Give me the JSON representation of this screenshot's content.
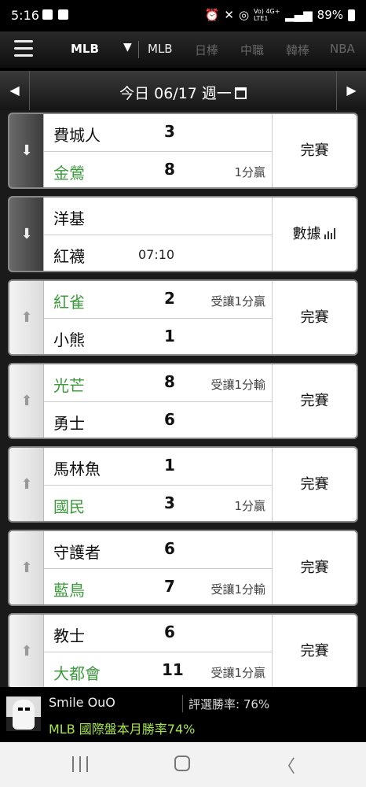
{
  "status_bar": {
    "time": "5:16",
    "network": "Vo) 4G+ LTE1",
    "battery": "89%"
  },
  "nav": {
    "selected_league": "MLB",
    "tabs": [
      "MLB",
      "日棒",
      "中職",
      "韓棒",
      "NBA"
    ]
  },
  "date_bar": {
    "date_text": "今日 06/17 週一"
  },
  "games": [
    {
      "arrow": "down",
      "away": {
        "name": "費城人",
        "score": "3",
        "note": "",
        "win": false
      },
      "home": {
        "name": "金鶯",
        "score": "8",
        "note": "1分贏",
        "win": true
      },
      "status": "完賽"
    },
    {
      "arrow": "down",
      "away": {
        "name": "洋基",
        "score": "",
        "note": "",
        "win": false
      },
      "home": {
        "name": "紅襪",
        "score": "",
        "note": "",
        "win": false,
        "time": "07:10"
      },
      "status": "數據"
    },
    {
      "arrow": "up",
      "away": {
        "name": "紅雀",
        "score": "2",
        "note": "受讓1分贏",
        "win": true
      },
      "home": {
        "name": "小熊",
        "score": "1",
        "note": "",
        "win": false
      },
      "status": "完賽"
    },
    {
      "arrow": "up",
      "away": {
        "name": "光芒",
        "score": "8",
        "note": "受讓1分輸",
        "win": true
      },
      "home": {
        "name": "勇士",
        "score": "6",
        "note": "",
        "win": false
      },
      "status": "完賽"
    },
    {
      "arrow": "up",
      "away": {
        "name": "馬林魚",
        "score": "1",
        "note": "",
        "win": false
      },
      "home": {
        "name": "國民",
        "score": "3",
        "note": "1分贏",
        "win": true
      },
      "status": "完賽"
    },
    {
      "arrow": "up",
      "away": {
        "name": "守護者",
        "score": "6",
        "note": "",
        "win": false
      },
      "home": {
        "name": "藍鳥",
        "score": "7",
        "note": "受讓1分輸",
        "win": true
      },
      "status": "完賽"
    },
    {
      "arrow": "up",
      "away": {
        "name": "教士",
        "score": "6",
        "note": "",
        "win": false
      },
      "home": {
        "name": "大都會",
        "score": "11",
        "note": "受讓1分贏",
        "win": true
      },
      "status": "完賽"
    }
  ],
  "user_bar": {
    "username": "Smile OuO",
    "rating": "評選勝率: 76%",
    "monthly": "MLB 國際盤本月勝率74%"
  },
  "colors": {
    "win_text": "#3c9a3c",
    "monthly_text": "#a6e34a"
  }
}
